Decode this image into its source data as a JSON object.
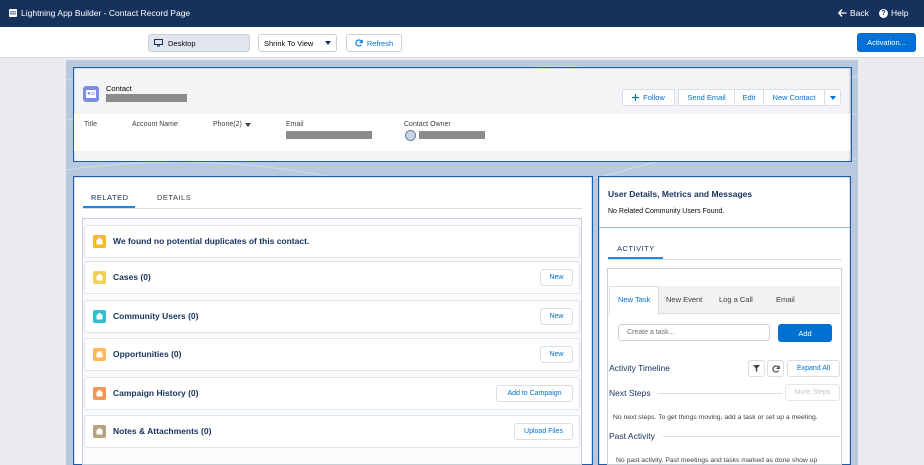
{
  "app": {
    "title": "Lightning App Builder - Contact Record Page",
    "back_label": "Back",
    "help_label": "Help"
  },
  "toolbar": {
    "device": "Desktop",
    "view_mode": "Shrink To View",
    "refresh_label": "Refresh",
    "activation_label": "Activation..."
  },
  "highlights": {
    "object_label": "Contact",
    "actions": [
      "Follow",
      "Send Email",
      "Edit",
      "New Contact"
    ],
    "fields": [
      "Title",
      "Account Name",
      "Phone(2)",
      "Email",
      "Contact Owner"
    ]
  },
  "left_tabs": [
    "RELATED",
    "DETAILS"
  ],
  "related_lists": [
    {
      "title": "We found no potential duplicates of this contact.",
      "icon": "duplicate-icon",
      "color": "#f4bc25",
      "button": ""
    },
    {
      "title": "Cases (0)",
      "icon": "case-icon",
      "color": "#f2cf5b",
      "button": "New"
    },
    {
      "title": "Community Users (0)",
      "icon": "community-icon",
      "color": "#34becd",
      "button": "New"
    },
    {
      "title": "Opportunities (0)",
      "icon": "opportunity-icon",
      "color": "#fcb95b",
      "button": "New"
    },
    {
      "title": "Campaign History (0)",
      "icon": "campaign-icon",
      "color": "#f49756",
      "button": "Add to Campaign"
    },
    {
      "title": "Notes & Attachments (0)",
      "icon": "note-icon",
      "color": "#b7a47e",
      "button": "Upload Files"
    }
  ],
  "right": {
    "user_details_title": "User Details, Metrics and Messages",
    "user_details_body": "No Related Community Users Found.",
    "activity_tab": "ACTIVITY",
    "publisher_tabs": [
      "New Task",
      "New Event",
      "Log a Call",
      "Email"
    ],
    "task_placeholder": "Create a task...",
    "add_label": "Add",
    "timeline_label": "Activity Timeline",
    "expand_all": "Expand All",
    "next_steps_label": "Next Steps",
    "more_steps": "More Steps",
    "next_steps_empty": "No next steps. To get things moving, add a task or set up a meeting.",
    "past_activity_label": "Past Activity",
    "past_activity_empty": "No past activity. Past meetings and tasks marked as done show up"
  },
  "colors": {
    "nav": "#16325c",
    "brand": "#0070d2",
    "frame": "#1f5ba8"
  }
}
